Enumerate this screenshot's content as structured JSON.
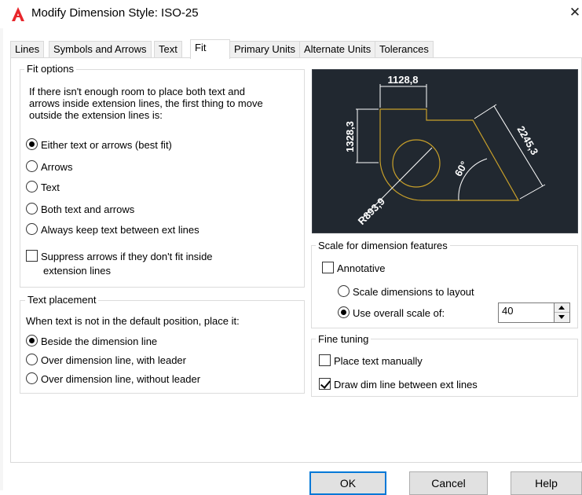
{
  "window": {
    "title": "Modify Dimension Style: ISO-25",
    "close_label": "✕"
  },
  "tabs": [
    {
      "label": "Lines"
    },
    {
      "label": "Symbols and Arrows"
    },
    {
      "label": "Text"
    },
    {
      "label": "Fit"
    },
    {
      "label": "Primary Units"
    },
    {
      "label": "Alternate Units"
    },
    {
      "label": "Tolerances"
    }
  ],
  "fit_options": {
    "legend": "Fit options",
    "description": "If there isn't enough room to place both text and arrows inside extension lines, the first thing to move outside the extension lines is:",
    "options": [
      {
        "label": "Either text or arrows (best fit)",
        "checked": true
      },
      {
        "label": "Arrows",
        "checked": false
      },
      {
        "label": "Text",
        "checked": false
      },
      {
        "label": "Both text and arrows",
        "checked": false
      },
      {
        "label": "Always keep text between ext lines",
        "checked": false
      }
    ],
    "suppress_label_line1": "Suppress arrows if they don't fit inside",
    "suppress_label_line2": "extension lines",
    "suppress_checked": false
  },
  "text_placement": {
    "legend": "Text placement",
    "description": "When text is not in the default position, place it:",
    "options": [
      {
        "label": "Beside the dimension line",
        "checked": true
      },
      {
        "label": "Over dimension line, with leader",
        "checked": false
      },
      {
        "label": "Over dimension line, without leader",
        "checked": false
      }
    ]
  },
  "preview": {
    "dim_top": "1128,8",
    "dim_left": "1328,3",
    "dim_diag": "2245,3",
    "dim_angle": "60°",
    "dim_radius": "R893,9",
    "colors": {
      "background": "#212830",
      "geometry": "#c8a02a",
      "dims": "#ffffff"
    }
  },
  "scale": {
    "legend": "Scale for dimension features",
    "annotative_label": "Annotative",
    "annotative_checked": false,
    "layout_label": "Scale dimensions to layout",
    "layout_checked": false,
    "overall_label": "Use overall scale of:",
    "overall_checked": true,
    "overall_value": "40"
  },
  "fine_tuning": {
    "legend": "Fine tuning",
    "manual_label": "Place text manually",
    "manual_checked": false,
    "dimline_label": "Draw dim line between ext lines",
    "dimline_checked": true
  },
  "buttons": {
    "ok": "OK",
    "cancel": "Cancel",
    "help": "Help"
  }
}
